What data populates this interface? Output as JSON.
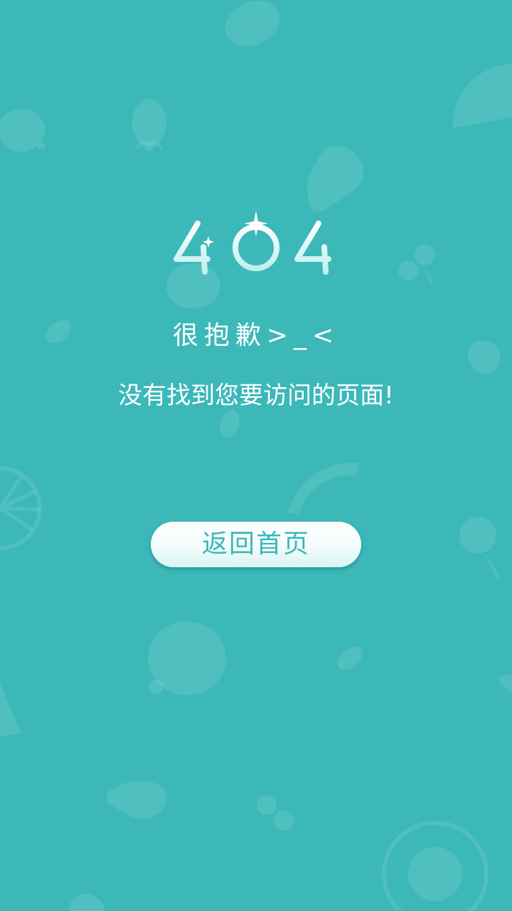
{
  "page": {
    "error_code": "404",
    "sorry_text": "很抱歉>_<",
    "message_text": "没有找到您要访问的页面!",
    "home_button_label": "返回首页"
  },
  "theme": {
    "background": "#3cb8b9",
    "button_text": "#3cb8b9",
    "text": "#ffffff"
  },
  "icons": [
    "avocado-icon",
    "watermelon-icon",
    "lemon-icon",
    "pineapple-icon",
    "pear-icon",
    "cherry-icon",
    "strawberry-icon",
    "orange-slice-icon",
    "melon-slice-icon",
    "kiwi-icon",
    "leaf-icon"
  ]
}
